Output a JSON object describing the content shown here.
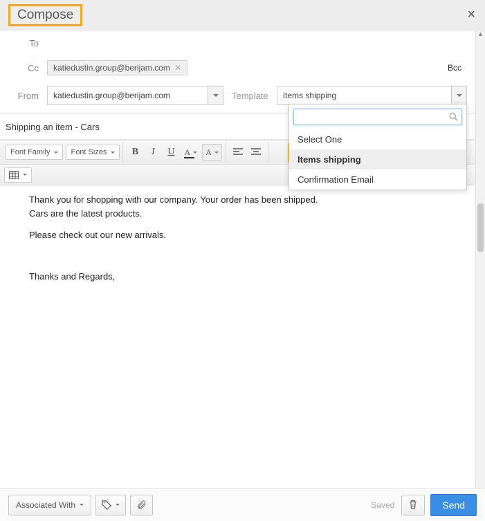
{
  "header": {
    "title": "Compose"
  },
  "fields": {
    "to_label": "To",
    "cc_label": "Cc",
    "cc_chip": "katiedustin.group@berijam.com",
    "bcc_label": "Bcc",
    "from_label": "From",
    "from_value": "katiedustin.group@berijam.com",
    "template_label": "Template",
    "template_value": "Items shipping",
    "subject": "Shipping an item - Cars"
  },
  "toolbar": {
    "font_family": "Font Family",
    "font_sizes": "Font Sizes"
  },
  "body": {
    "l1": "Thank you for shopping with our company. Your order has been shipped.",
    "l2": "Cars are the latest products.",
    "l3": "Please check out our new arrivals.",
    "l4": "Thanks and Regards,"
  },
  "dropdown": {
    "opt0": "Select One",
    "opt1": "Items shipping",
    "opt2": "Confirmation Email"
  },
  "footer": {
    "associated": "Associated With",
    "saved": "Saved",
    "send": "Send"
  }
}
